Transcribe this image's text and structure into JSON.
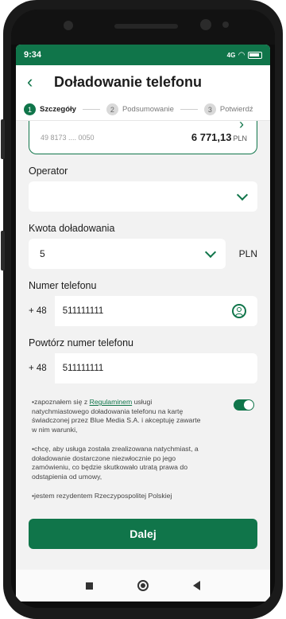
{
  "status_bar": {
    "time": "9:34",
    "signal": "4G"
  },
  "header": {
    "back_icon": "chevron-left-icon",
    "title": "Doładowanie telefonu"
  },
  "stepper": [
    {
      "num": "1",
      "label": "Szczegóły",
      "active": true
    },
    {
      "num": "2",
      "label": "Podsumowanie",
      "active": false
    },
    {
      "num": "3",
      "label": "Potwierdź",
      "active": false
    }
  ],
  "account": {
    "number": "49 8173 .... 0050",
    "amount": "6 771,13",
    "currency": "PLN"
  },
  "operator": {
    "label": "Operator",
    "value": ""
  },
  "amount": {
    "label": "Kwota doładowania",
    "value": "5",
    "currency": "PLN"
  },
  "phone": {
    "label": "Numer telefonu",
    "prefix": "+ 48",
    "value": "511111111"
  },
  "phone_repeat": {
    "label": "Powtórz numer telefonu",
    "prefix": "+ 48",
    "value": "511111111"
  },
  "consents": {
    "c1_before": "•zapoznałem się z ",
    "c1_link": "Regulaminem",
    "c1_after": " usługi natychmiastowego doładowania telefonu na kartę świadczonej przez Blue Media S.A. i akceptuję zawarte w nim warunki,",
    "c2": "•chcę, aby usługa została zrealizowana natychmiast, a doładowanie dostarczone niezwłocznie po jego zamówieniu, co będzie skutkowało utratą prawa do odstąpienia od umowy,",
    "c3": "•jestem rezydentem Rzeczypospolitej Polskiej"
  },
  "actions": {
    "next_label": "Dalej"
  },
  "colors": {
    "accent": "#10754a",
    "background": "#f2f2f2"
  }
}
